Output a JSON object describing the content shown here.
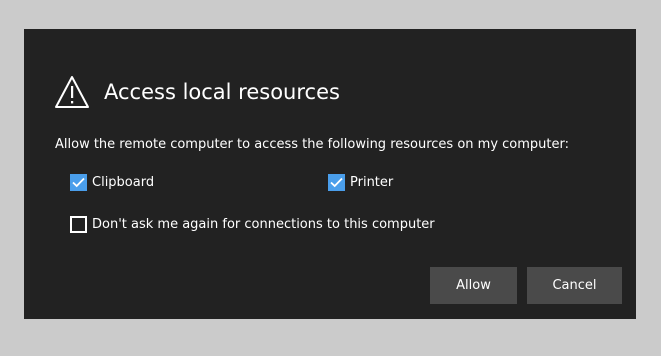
{
  "dialog": {
    "title": "Access local resources",
    "icon": "warning-icon",
    "instruction": "Allow the remote computer to access the following resources on my computer:",
    "options": {
      "clipboard": {
        "label": "Clipboard",
        "checked": true
      },
      "printer": {
        "label": "Printer",
        "checked": true
      },
      "dont_ask": {
        "label": "Don't ask me again for connections to this computer",
        "checked": false
      }
    },
    "buttons": {
      "allow_label": "Allow",
      "cancel_label": "Cancel"
    }
  },
  "colors": {
    "page_background": "#cbcbcb",
    "dialog_background": "#222222",
    "checkbox_accent": "#4a9eeb",
    "button_background": "#4a4a4a"
  }
}
